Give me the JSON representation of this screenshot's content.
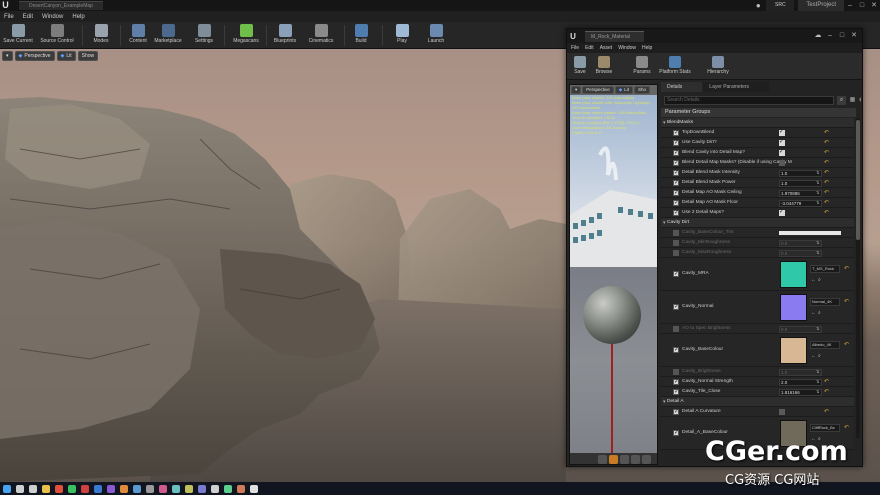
{
  "titlebar": {
    "doc_tab": "DesertCanyon_ExampleMap",
    "source_label": "SRC",
    "project_name": "TestProject",
    "min_glyph": "–",
    "max_glyph": "□",
    "close_glyph": "✕"
  },
  "menu": [
    "File",
    "Edit",
    "Window",
    "Help"
  ],
  "toolbar": [
    {
      "label": "Save Current",
      "color": "#8a9ba8"
    },
    {
      "label": "Source Control",
      "color": "#7d7d7d"
    },
    {
      "label": "Modes",
      "color": "#9aa3ad"
    },
    {
      "label": "Content",
      "color": "#5f7fa8"
    },
    {
      "label": "Marketplace",
      "color": "#4b6a8d"
    },
    {
      "label": "Settings",
      "color": "#7f8c99"
    },
    {
      "label": "Megascans",
      "color": "#6fbf4a"
    },
    {
      "label": "Blueprints",
      "color": "#8aa0b8"
    },
    {
      "label": "Cinematics",
      "color": "#8a8a8a"
    },
    {
      "label": "Build",
      "color": "#4f7db0"
    },
    {
      "label": "Play",
      "color": "#9fb8d6"
    },
    {
      "label": "Launch",
      "color": "#6a8ab0"
    }
  ],
  "viewport": {
    "perspective": "Perspective",
    "lit": "Lit",
    "show": "Show"
  },
  "mat_editor": {
    "tab_label": "M_Rock_Material",
    "menu": [
      "File",
      "Edit",
      "Asset",
      "Window",
      "Help"
    ],
    "tools": [
      {
        "label": "Save",
        "color": "#8a9ba8"
      },
      {
        "label": "Browse",
        "color": "#9a8a6a"
      },
      {
        "label": "Params",
        "color": "#8a8a8a"
      },
      {
        "label": "Platform Stats",
        "color": "#4f7db0"
      },
      {
        "label": "Hierarchy",
        "color": "#7d8fa8"
      }
    ],
    "preview": {
      "perspective": "Perspective",
      "lit": "Lit",
      "show": "Sho",
      "stats_text": "Base pass shader: 241 instructions\nBase pass shader with Volumetric Lightmap: 293 instructions\nBase pass vertex shader: 165 instructions\nTexture samplers: 15/16\nTexture Lookups (Est.): VS(3), PS(17)\nUser interpolators: 2/4 Scalars\nShader Count: 8"
    },
    "details": {
      "tab_details": "Details",
      "tab_layers": "Layer Parameters",
      "search_placeholder": "Search Details",
      "header": "Parameter Groups",
      "groups": {
        "blend": "BlendMasks",
        "cavity": "Cavity Dirt",
        "detail": "Detail A"
      },
      "blend_rows": [
        {
          "name": "TopDownBlend",
          "kind": "bool",
          "value": true
        },
        {
          "name": "Use Cavity Dirt?",
          "kind": "bool",
          "value": true
        },
        {
          "name": "Blend Cavity into Detail Map?",
          "kind": "bool",
          "value": true
        },
        {
          "name": "Blend Detail Map Masks? (Disable if using Cavity M",
          "kind": "bool",
          "value": false
        },
        {
          "name": "Detail Blend Mask Intensity",
          "kind": "num",
          "value": "1.0"
        },
        {
          "name": "Detail Blend Mask Power",
          "kind": "num",
          "value": "1.0"
        },
        {
          "name": "Detail Map AO Mask Ceiling",
          "kind": "num",
          "value": "1.970886"
        },
        {
          "name": "Detail Map AO Mask Floor",
          "kind": "num",
          "value": "-3.044779"
        },
        {
          "name": "Use 2 Detail Maps?",
          "kind": "bool",
          "value": true
        }
      ],
      "cavity_dim_rows": [
        {
          "name": "Cavity_BaseColour_Tint",
          "kind": "color"
        },
        {
          "name": "Cavity_MinRoughness",
          "kind": "num",
          "value": "0.0"
        },
        {
          "name": "Cavity_MaxRoughness",
          "kind": "num",
          "value": "0.0"
        }
      ],
      "cavity_tex_rows": [
        {
          "name": "Cavity_MRA",
          "file": "T_MS_Rock",
          "color": "#2fc8a8"
        },
        {
          "name": "Cavity_Normal",
          "file": "Normal_4K",
          "color": "#8a7cf0"
        }
      ],
      "cavity_mid_row": {
        "name": "AO to Spec Brightness",
        "value": "0.0"
      },
      "cavity_tex_row2": {
        "name": "Cavity_BaseColour",
        "file": "Albedo_4K",
        "color": "#d8b894"
      },
      "cavity_tail_rows": [
        {
          "name": "Cavity_Brightness",
          "value": "1.0",
          "dim": true
        },
        {
          "name": "Cavity_Normal Strength",
          "value": "2.0",
          "dim": false
        },
        {
          "name": "Cavity_Tile_Close",
          "value": "1.816166",
          "dim": false
        }
      ],
      "detail_rows": [
        {
          "name": "Detail A Curvature",
          "kind": "bool",
          "value": false
        }
      ],
      "detail_tex_rows": [
        {
          "name": "Detail_A_BaseColour",
          "file": "CliffRock_Bc",
          "color": "#6f6a5a"
        }
      ]
    }
  },
  "watermark": {
    "big": "CGer.com",
    "small": "CG资源 CG网站"
  }
}
